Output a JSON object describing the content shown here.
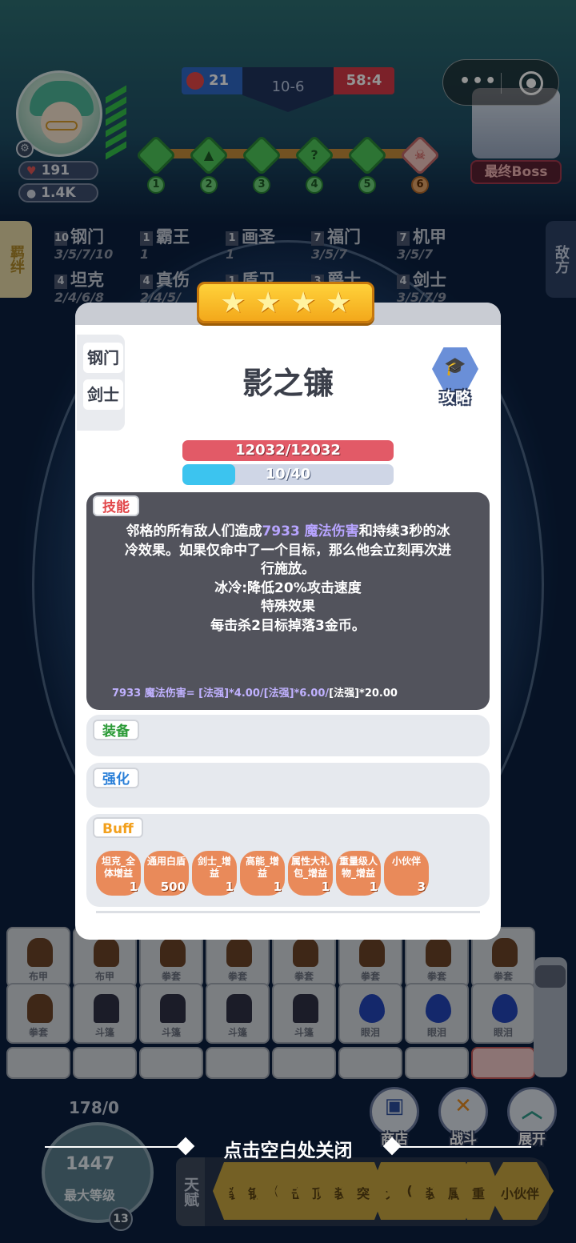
{
  "hud": {
    "hp": "191",
    "coins": "1.4K",
    "score_blue": "21",
    "stage": "10-6",
    "timer": "58:4",
    "stage_nodes": [
      "1",
      "2",
      "3",
      "4",
      "5",
      "6"
    ],
    "boss_label": "最终Boss",
    "menu_dots": "•••"
  },
  "side_tabs": {
    "left": "羁绊",
    "right": "敌方"
  },
  "synergies": [
    {
      "count": "10",
      "name": "钢门",
      "thresholds": "3/5/7/10"
    },
    {
      "count": "1",
      "name": "霸王",
      "thresholds": "1"
    },
    {
      "count": "1",
      "name": "画圣",
      "thresholds": "1"
    },
    {
      "count": "7",
      "name": "福门",
      "thresholds": "3/5/7"
    },
    {
      "count": "7",
      "name": "机甲",
      "thresholds": "3/5/7"
    },
    {
      "count": "4",
      "name": "坦克",
      "thresholds": "2/4/6/8"
    },
    {
      "count": "4",
      "name": "真伤",
      "thresholds": "2/4/5/"
    },
    {
      "count": "1",
      "name": "盾卫",
      "thresholds": ""
    },
    {
      "count": "3",
      "name": "爵士",
      "thresholds": ""
    },
    {
      "count": "4",
      "name": "剑士",
      "thresholds": "3/5/7/9"
    }
  ],
  "modal": {
    "type_tabs": [
      "钢门",
      "剑士"
    ],
    "hero_name": "影之镰",
    "guide_label": "攻略",
    "hp_text": "12032/12032",
    "mana_text": "10/40",
    "mana_fraction": 0.25,
    "skill": {
      "label": "技能",
      "line1_a": "邻格的所有敌人们造成",
      "line1_hl": "7933 魔法伤害",
      "line1_b": "和持续3秒的冰",
      "line2": "冷效果。如果仅命中了一个目标，那么他会立刻再次进",
      "line3": "行施放。",
      "line4": "冰冷:降低20%攻击速度",
      "line5": "特殊效果",
      "line6": "每击杀2目标掉落3金币。",
      "formula_a": "7933 魔法伤害= [法强]*4.00/[法强]*6.00/",
      "formula_b": "[法强]*20.00"
    },
    "equip_label": "装备",
    "boost_label": "强化",
    "buff_label": "Buff",
    "buffs": [
      {
        "name": "坦克_全体增益",
        "value": "1"
      },
      {
        "name": "通用白盾",
        "value": "500"
      },
      {
        "name": "剑士_增益",
        "value": "1"
      },
      {
        "name": "高能_增益",
        "value": "1"
      },
      {
        "name": "属性大礼包_增益",
        "value": "1"
      },
      {
        "name": "重量级人物_增益",
        "value": "1"
      },
      {
        "name": "小伙伴",
        "value": "3"
      }
    ]
  },
  "inventory": {
    "row1": [
      "布甲",
      "布甲",
      "拳套",
      "拳套",
      "拳套",
      "拳套",
      "拳套",
      "拳套"
    ],
    "row2": [
      "拳套",
      "斗篷",
      "斗篷",
      "斗篷",
      "斗篷",
      "眼泪",
      "眼泪",
      "眼泪"
    ]
  },
  "buttons": {
    "shop": "商店",
    "fight": "战斗",
    "expand": "展开"
  },
  "bottom": {
    "exp": "178/0",
    "coins": "1447",
    "max_level_label": "最大等级",
    "level": "13",
    "close_hint": "点击空白处关闭",
    "talent_label": "天赋",
    "cards": [
      "装",
      "钢",
      "(",
      "击",
      "顶",
      "装",
      "突",
      "大",
      "(",
      "装",
      "属",
      "重",
      "小伙伴"
    ]
  },
  "colors": {
    "hp_bar": "#e25a67",
    "mana_bar": "#3cc4ef",
    "skill_label": "#e2474a",
    "equip_label": "#2a9a36",
    "boost_label": "#2a7fd8",
    "buff_label": "#f2a01d"
  }
}
